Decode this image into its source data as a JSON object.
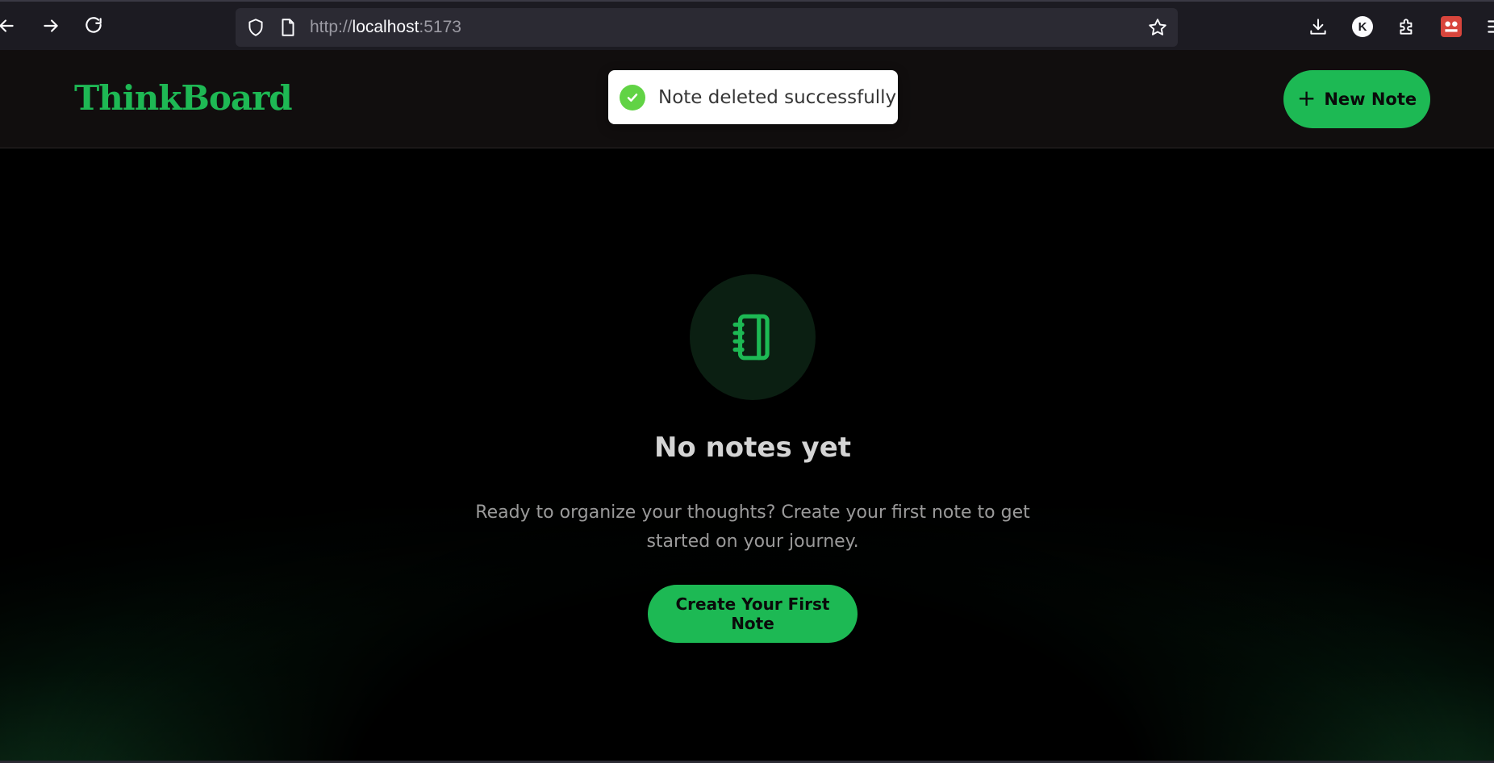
{
  "browser": {
    "url_prefix": "http://",
    "url_host": "localhost",
    "url_suffix": ":5173",
    "profile_initial": "K",
    "icons": {
      "back": "arrow-left-icon",
      "forward": "arrow-right-icon",
      "reload": "reload-icon",
      "shield": "shield-icon",
      "page": "page-icon",
      "bookmark": "star-icon",
      "downloads": "download-icon",
      "extensions": "puzzle-icon",
      "menu": "hamburger-menu-icon"
    }
  },
  "header": {
    "logo": "ThinkBoard",
    "new_note_label": "New Note"
  },
  "toast": {
    "message": "Note deleted successfully",
    "status": "success"
  },
  "empty_state": {
    "title": "No notes yet",
    "description": "Ready to organize your thoughts? Create your first note to get started on your journey.",
    "cta_label": "Create Your First Note"
  },
  "colors": {
    "accent": "#1db954",
    "logo": "#1eb854",
    "toast_success": "#61d345",
    "background": "#000000",
    "header_bg": "#110e0e"
  }
}
